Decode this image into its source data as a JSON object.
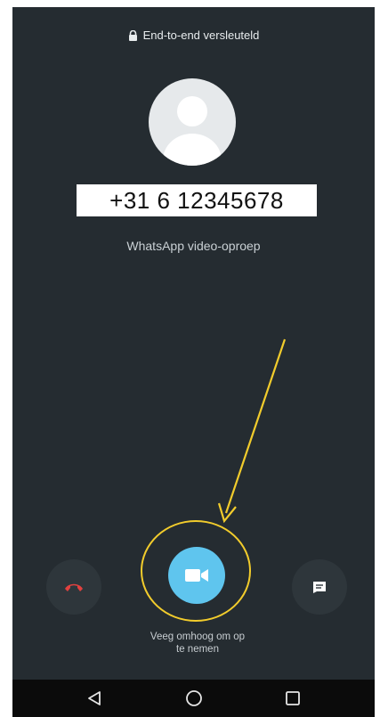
{
  "header": {
    "encryption_text": "End-to-end versleuteld"
  },
  "caller": {
    "phone_number": "+31 6 12345678",
    "call_type": "WhatsApp video-oproep"
  },
  "actions": {
    "decline_icon": "phone-hangup-icon",
    "accept_icon": "video-camera-icon",
    "message_icon": "message-icon",
    "swipe_hint_line1": "Veeg omhoog om op",
    "swipe_hint_line2": "te nemen"
  },
  "navigation": {
    "back_icon": "back-triangle-icon",
    "home_icon": "home-circle-icon",
    "recents_icon": "recents-square-icon"
  },
  "colors": {
    "background": "#252c31",
    "accept": "#5fc5ee",
    "decline": "#e2413f",
    "annotation": "#f2cc2c"
  }
}
